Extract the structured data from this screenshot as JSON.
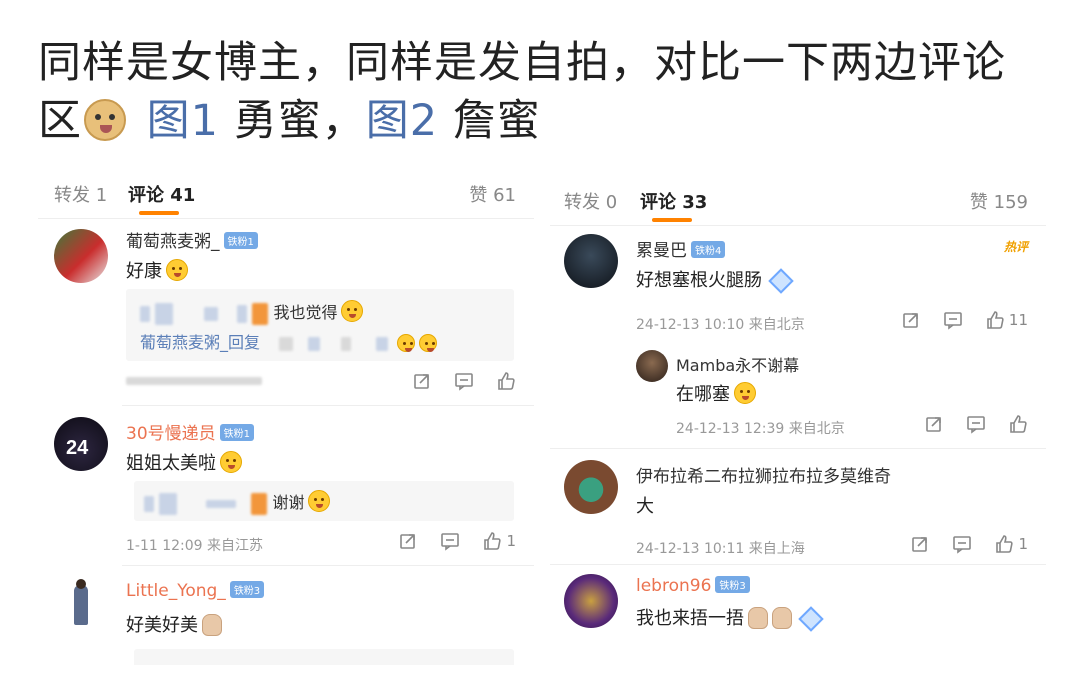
{
  "headline": {
    "line1": "同样是女博主，同样是发自拍，对比一下两边评论",
    "line2_prefix": "区",
    "fig1": "图1",
    "fig1_label": " 勇蜜，",
    "fig2": "图2",
    "fig2_label": " 詹蜜"
  },
  "panel1": {
    "repost_tab": "转发 1",
    "comment_tab": "评论 41",
    "likes_tab": "赞 61",
    "comments": [
      {
        "user": "葡萄燕麦粥_",
        "badge": "铁粉1",
        "text": "好康",
        "reply_text": "我也觉得",
        "reply_name": "葡萄燕麦粥_回复"
      },
      {
        "user": "30号慢递员",
        "badge": "铁粉1",
        "text": "姐姐太美啦",
        "reply_text": "谢谢",
        "meta": "1-11 12:09 来自江苏",
        "likes": "1"
      },
      {
        "user": "Little_Yong_",
        "badge": "铁粉3",
        "text": "好美好美"
      }
    ]
  },
  "panel2": {
    "repost_tab": "转发 0",
    "comment_tab": "评论 33",
    "likes_tab": "赞 159",
    "hot_label": "热评",
    "comments": [
      {
        "user": "累曼巴",
        "badge": "铁粉4",
        "text": "好想塞根火腿肠",
        "meta": "24-12-13 10:10 来自北京",
        "likes": "11"
      },
      {
        "user": "Mamba永不谢幕",
        "text": "在哪塞",
        "meta": "24-12-13 12:39 来自北京"
      },
      {
        "user": "伊布拉希二布拉狮拉布拉多莫维奇",
        "text": "大",
        "meta": "24-12-13 10:11 来自上海",
        "likes": "1"
      },
      {
        "user": "lebron96",
        "badge": "铁粉3",
        "text": "我也来捂一捂"
      }
    ]
  },
  "colors": {
    "accent_orange": "#ff8200",
    "link_blue": "#4a6ea9",
    "username_orange": "#eb7350"
  }
}
